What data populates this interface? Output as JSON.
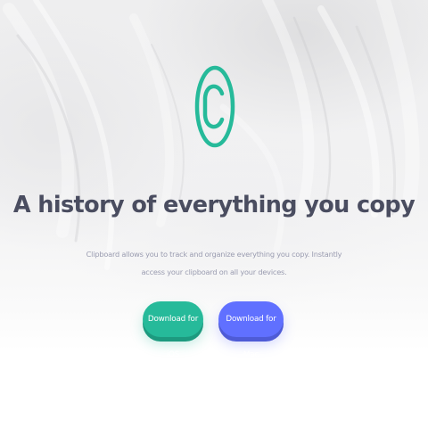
{
  "hero": {
    "logo_icon": "copyright-circle-icon",
    "title": "A history of everything you copy",
    "description": "Clipboard allows you to track and organize everything you copy. Instantly access your clipboard on all your devices."
  },
  "actions": {
    "ios_label": "Download for iOS",
    "mac_label": "Download for Mac"
  },
  "colors": {
    "heading": "#4a4d60",
    "body_text": "#9a9cb0",
    "ios_button": "#26ba9a",
    "mac_button": "#6070ff",
    "logo_accent": "#26ba9a"
  }
}
